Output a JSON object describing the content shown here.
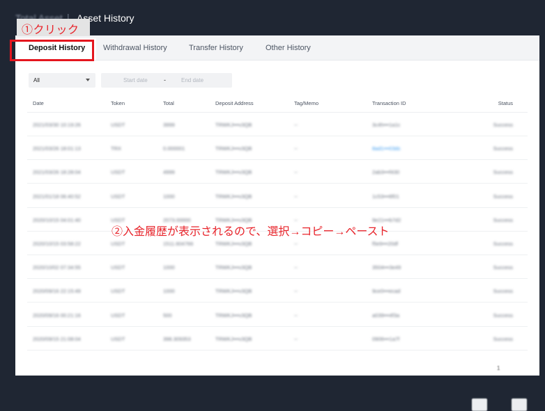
{
  "breadcrumb": {
    "parent": "Total Asset",
    "separator": "|",
    "current": "Asset History"
  },
  "step_label": "①クリック",
  "tabs": [
    {
      "label": "Deposit History",
      "active": true
    },
    {
      "label": "Withdrawal History",
      "active": false
    },
    {
      "label": "Transfer History",
      "active": false
    },
    {
      "label": "Other History",
      "active": false
    }
  ],
  "filters": {
    "token_select": "All",
    "start_placeholder": "Start date",
    "separator": "-",
    "end_placeholder": "End date"
  },
  "table": {
    "headers": [
      "Date",
      "Token",
      "Total",
      "Deposit Address",
      "Tag/Memo",
      "Transaction ID",
      "Status"
    ],
    "rows": [
      [
        "2021/03/30 10:19:26",
        "USDT",
        "3999",
        "TRWKJ•••v3QB",
        "--",
        "3c4h•••1a1c",
        "Success"
      ],
      [
        "2021/03/26 18:01:13",
        "TRX",
        "0.000001",
        "TRWKJ•••v3QB",
        "--",
        "8ad1•••03dc",
        "Success"
      ],
      [
        "2021/03/26 18:28:04",
        "USDT",
        "4999",
        "TRWKJ•••v3QB",
        "--",
        "2ab3•••f430",
        "Success"
      ],
      [
        "2021/01/18 06:40:52",
        "USDT",
        "1000",
        "TRWKJ•••v3QB",
        "--",
        "1c53•••6f01",
        "Success"
      ],
      [
        "2020/10/15 04:01:40",
        "USDT",
        "2073.00000",
        "TRWKJ•••v3QB",
        "--",
        "9e21•••b7d2",
        "Success"
      ],
      [
        "2020/10/15 03:58:22",
        "USDT",
        "1511.604766",
        "TRWKJ•••v3QB",
        "--",
        "f5e9•••20df",
        "Success"
      ],
      [
        "2020/10/02 07:34:55",
        "USDT",
        "1000",
        "TRWKJ•••v3QB",
        "--",
        "3504•••3e49",
        "Success"
      ],
      [
        "2020/09/16 22:15:49",
        "USDT",
        "1000",
        "TRWKJ•••v3QB",
        "--",
        "9ce0•••ecad",
        "Success"
      ],
      [
        "2020/09/16 00:21:16",
        "USDT",
        "500",
        "TRWKJ•••v3QB",
        "--",
        "a039•••4f3a",
        "Success"
      ],
      [
        "2020/09/15 21:08:04",
        "USDT",
        "398.309353",
        "TRWKJ•••v3QB",
        "--",
        "0906•••1a7f",
        "Success"
      ]
    ]
  },
  "annotation": "②入金履歴が表示されるので、選択→コピー→ペースト",
  "pagination": {
    "page": "1"
  },
  "colors": {
    "accent_red": "#e4161e",
    "header_bg": "#1f2633",
    "link_blue": "#3b9bf0"
  }
}
